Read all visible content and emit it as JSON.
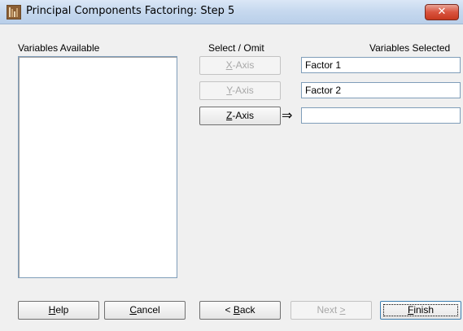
{
  "window": {
    "title": "Principal Components Factoring: Step 5",
    "close_glyph": "✕"
  },
  "labels": {
    "variables_available": "Variables Available",
    "select_omit": "Select / Omit",
    "variables_selected": "Variables Selected"
  },
  "axis_buttons": [
    {
      "key": "X",
      "rest": "-Axis",
      "enabled": false
    },
    {
      "key": "Y",
      "rest": "-Axis",
      "enabled": false
    },
    {
      "key": "Z",
      "rest": "-Axis",
      "enabled": true
    }
  ],
  "selected_fields": [
    "Factor 1",
    "Factor 2",
    ""
  ],
  "pointer_glyph": "⇒",
  "footer": {
    "help": {
      "key": "H",
      "rest": "elp"
    },
    "cancel": {
      "key": "C",
      "rest": "ancel"
    },
    "back": {
      "pre": "< ",
      "key": "B",
      "rest": "ack"
    },
    "next": {
      "pre": "Next ",
      "key": ">"
    },
    "finish": {
      "key": "F",
      "rest": "inish"
    }
  },
  "icons": {
    "app": "app-icon",
    "close": "close-icon",
    "pointer": "arrow-right-icon"
  }
}
